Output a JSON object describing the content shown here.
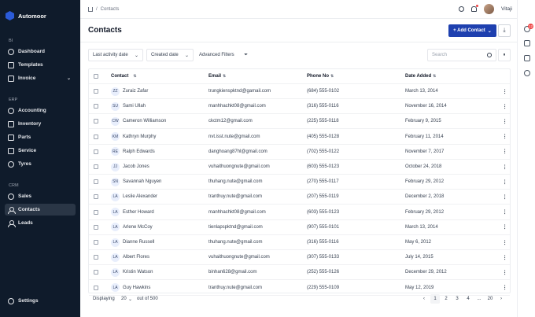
{
  "brand": {
    "name": "Automoor"
  },
  "sidebar": {
    "sections": [
      {
        "label": "BI"
      },
      {
        "label": "ERP"
      },
      {
        "label": "CRM"
      }
    ],
    "items": [
      {
        "label": "Dashboard",
        "icon": "dashboard-icon"
      },
      {
        "label": "Templates",
        "icon": "templates-icon"
      },
      {
        "label": "Invoice",
        "icon": "invoice-icon"
      },
      {
        "label": "Accounting",
        "icon": "accounting-icon"
      },
      {
        "label": "Inventory",
        "icon": "inventory-icon"
      },
      {
        "label": "Parts",
        "icon": "parts-icon"
      },
      {
        "label": "Service",
        "icon": "service-icon"
      },
      {
        "label": "Tyres",
        "icon": "tyres-icon"
      },
      {
        "label": "Sales",
        "icon": "sales-icon"
      },
      {
        "label": "Contacts",
        "icon": "contacts-icon",
        "active": true
      },
      {
        "label": "Leads",
        "icon": "leads-icon"
      }
    ],
    "settings_label": "Settings"
  },
  "topbar": {
    "breadcrumb": "Contacts",
    "user_name": "Vitaji"
  },
  "rail": {
    "badge": "12"
  },
  "page": {
    "title": "Contacts",
    "add_button": "+ Add Contact",
    "filters": {
      "activity": "Last activity date",
      "created": "Created date",
      "advanced": "Advanced Filters"
    },
    "search_placeholder": "Search"
  },
  "table": {
    "headers": {
      "contact": "Contact",
      "email": "Email",
      "phone": "Phone No",
      "date": "Date Added"
    },
    "rows": [
      {
        "initials": "ZZ",
        "name": "Zuraiz Zafar",
        "email": "trungkienspktnd@gamail.com",
        "phone": "(684) 555-0102",
        "date": "March 13, 2014"
      },
      {
        "initials": "SU",
        "name": "Sami Ullah",
        "email": "manhhachkt08@gmail.com",
        "phone": "(316) 555-0116",
        "date": "November 16, 2014"
      },
      {
        "initials": "CW",
        "name": "Cameron Williamson",
        "email": "ckctm12@gmail.com",
        "phone": "(225) 555-0118",
        "date": "February 9, 2015"
      },
      {
        "initials": "KM",
        "name": "Kathryn Murphy",
        "email": "nvt.isst.nute@gmail.com",
        "phone": "(405) 555-0128",
        "date": "February 11, 2014"
      },
      {
        "initials": "RE",
        "name": "Ralph Edwards",
        "email": "danghoang87hl@gmail.com",
        "phone": "(702) 555-0122",
        "date": "November 7, 2017"
      },
      {
        "initials": "JJ",
        "name": "Jacob Jones",
        "email": "vuhaithuongnute@gmail.com",
        "phone": "(603) 555-0123",
        "date": "October 24, 2018"
      },
      {
        "initials": "SN",
        "name": "Savannah Nguyen",
        "email": "thuhang.nute@gmail.com",
        "phone": "(270) 555-0117",
        "date": "February 29, 2012"
      },
      {
        "initials": "LA",
        "name": "Leslie Alexander",
        "email": "tranthuy.nute@gmail.com",
        "phone": "(207) 555-0119",
        "date": "December 2, 2018"
      },
      {
        "initials": "LA",
        "name": "Esther Howard",
        "email": "manhhachkt08@gmail.com",
        "phone": "(603) 555-0123",
        "date": "February 29, 2012"
      },
      {
        "initials": "LA",
        "name": "Arlene McCoy",
        "email": "tienlapspktnd@gmail.com",
        "phone": "(907) 555-0101",
        "date": "March 13, 2014"
      },
      {
        "initials": "LA",
        "name": "Dianne Russell",
        "email": "thuhang.nute@gmail.com",
        "phone": "(316) 555-0116",
        "date": "May 6, 2012"
      },
      {
        "initials": "LA",
        "name": "Albert Flores",
        "email": "vuhaithuongnute@gmail.com",
        "phone": "(307) 555-0133",
        "date": "July 14, 2015"
      },
      {
        "initials": "LA",
        "name": "Kristin Watson",
        "email": "binhan628@gmail.com",
        "phone": "(252) 555-0126",
        "date": "December 29, 2012"
      },
      {
        "initials": "LA",
        "name": "Guy Hawkins",
        "email": "tranthuy.nute@gmail.com",
        "phone": "(229) 555-0109",
        "date": "May 12, 2019"
      }
    ]
  },
  "footer": {
    "displaying": "Displaying",
    "per_page": "20",
    "of_total": "out of 500",
    "pages": [
      "1",
      "2",
      "3",
      "4",
      "...",
      "20"
    ],
    "prev": "‹",
    "next": "›"
  }
}
